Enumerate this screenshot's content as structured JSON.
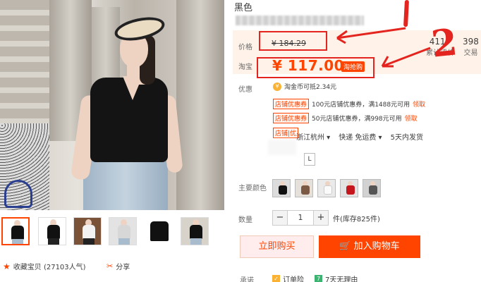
{
  "product": {
    "title": "黑色"
  },
  "price": {
    "label": "价格",
    "original": "¥ 184.29"
  },
  "taobao_price": {
    "label": "淘宝",
    "value": "¥ 117.00",
    "badge": "淘抢购"
  },
  "stats": {
    "sales_num": "4117",
    "sales_label": "累计评价",
    "deals_num": "398",
    "deals_label": "交易"
  },
  "annotations": {
    "mark_two": "2"
  },
  "promos": {
    "label": "优惠",
    "coin_text": "淘金币可抵2.34元",
    "coupon_tag": "店铺优惠券",
    "coupon1": "100元店铺优惠券，满1488元可用",
    "coupon2": "50元店铺优惠券，满998元可用",
    "claim": "领取",
    "tag3": "店铺|优"
  },
  "shipping": {
    "from": "浙江杭州 ▾",
    "fee": "快递 免运费 ▾",
    "time": "5天内发货"
  },
  "sizes": [
    "L"
  ],
  "color": {
    "label": "主要颜色"
  },
  "quantity": {
    "label": "数量",
    "value": "1",
    "stock": "件(库存825件)",
    "dec": "−",
    "inc": "+"
  },
  "actions": {
    "buy_now": "立即购买",
    "add_cart": "加入购物车"
  },
  "promise": {
    "label": "承诺",
    "item1": "订单险",
    "item2": "7天无理由"
  },
  "left": {
    "collect": "收藏宝贝 (27103人气)",
    "share": "分享"
  },
  "colors": {
    "accent": "#ff4400",
    "annotation_red": "#e4241e"
  }
}
